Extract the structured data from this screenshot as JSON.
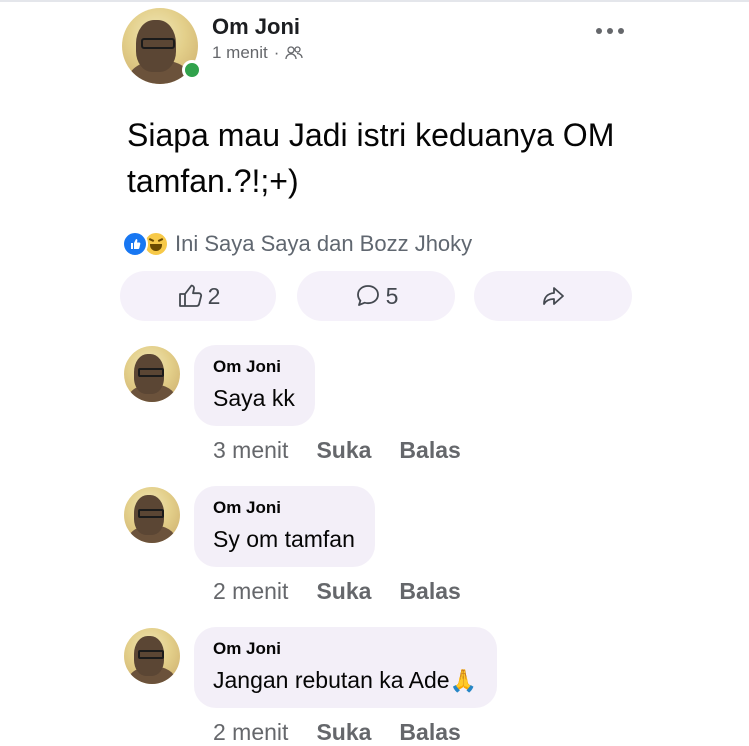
{
  "post": {
    "author": "Om Joni",
    "time": "1 menit",
    "separator": "·",
    "text": "Siapa mau Jadi istri keduanya OM tamfan.?!;+)",
    "reactions_text": "Ini Saya Saya dan Bozz Jhoky",
    "like_count": "2",
    "comment_count": "5"
  },
  "comments": [
    {
      "author": "Om Joni",
      "text": "Saya kk",
      "time": "3 menit",
      "like_label": "Suka",
      "reply_label": "Balas"
    },
    {
      "author": "Om Joni",
      "text": "Sy om tamfan",
      "time": "2 menit",
      "like_label": "Suka",
      "reply_label": "Balas"
    },
    {
      "author": "Om Joni",
      "text": "Jangan rebutan ka Ade",
      "emoji": "🙏",
      "time": "2 menit",
      "like_label": "Suka",
      "reply_label": "Balas"
    }
  ],
  "colors": {
    "like_blue": "#1877f2",
    "online_green": "#31a24c",
    "bubble_bg": "#f3eff8",
    "meta_gray": "#65676b"
  },
  "icons": [
    "more-options-icon",
    "group-privacy-icon",
    "like-reaction-icon",
    "haha-reaction-icon",
    "thumbs-up-icon",
    "comment-icon",
    "share-icon"
  ]
}
